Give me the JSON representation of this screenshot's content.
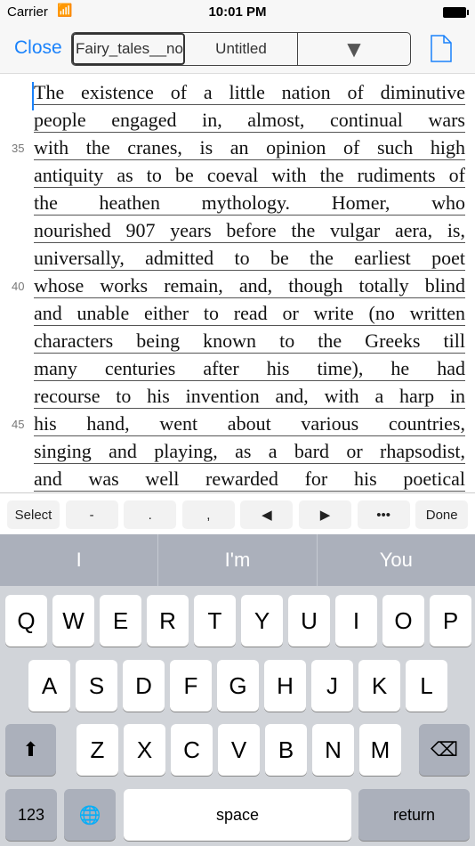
{
  "status": {
    "carrier": "Carrier",
    "time": "10:01 PM"
  },
  "nav": {
    "close": "Close",
    "segments": [
      "Fairy_tales__no",
      "Untitled",
      "▼"
    ]
  },
  "editor": {
    "lines": [
      "The existence of a little nation of diminutive",
      "people engaged in, almost, continual wars",
      "with the cranes, is an opinion of such high",
      "antiquity as to be coeval with the rudiments of",
      "the heathen mythology. Homer, who",
      "nourished 907 years before the vulgar aera, is,",
      "universally, admitted to be the earliest poet",
      "whose works remain, and, though totally blind",
      "and unable either to read or write (no written",
      "characters being known to the Greeks till",
      "many centuries after his time), he had",
      "recourse to his invention and, with a harp in",
      "his hand, went about various countries,",
      "singing and playing, as a bard or rhapsodist,",
      "and was well rewarded for his poetical"
    ],
    "line_numbers": [
      {
        "line": 3,
        "n": "35"
      },
      {
        "line": 8,
        "n": "40"
      },
      {
        "line": 13,
        "n": "45"
      }
    ]
  },
  "accessory": [
    "Select",
    "-",
    ".",
    ",",
    "◀",
    "▶",
    "•••",
    "Done"
  ],
  "keyboard": {
    "predictions": [
      "I",
      "I'm",
      "You"
    ],
    "row1": [
      "Q",
      "W",
      "E",
      "R",
      "T",
      "Y",
      "U",
      "I",
      "O",
      "P"
    ],
    "row2": [
      "A",
      "S",
      "D",
      "F",
      "G",
      "H",
      "J",
      "K",
      "L"
    ],
    "row3": [
      "Z",
      "X",
      "C",
      "V",
      "B",
      "N",
      "M"
    ],
    "numbers": "123",
    "globe": "🌐",
    "space": "space",
    "return": "return",
    "shift": "⬆",
    "delete": "⌫"
  }
}
